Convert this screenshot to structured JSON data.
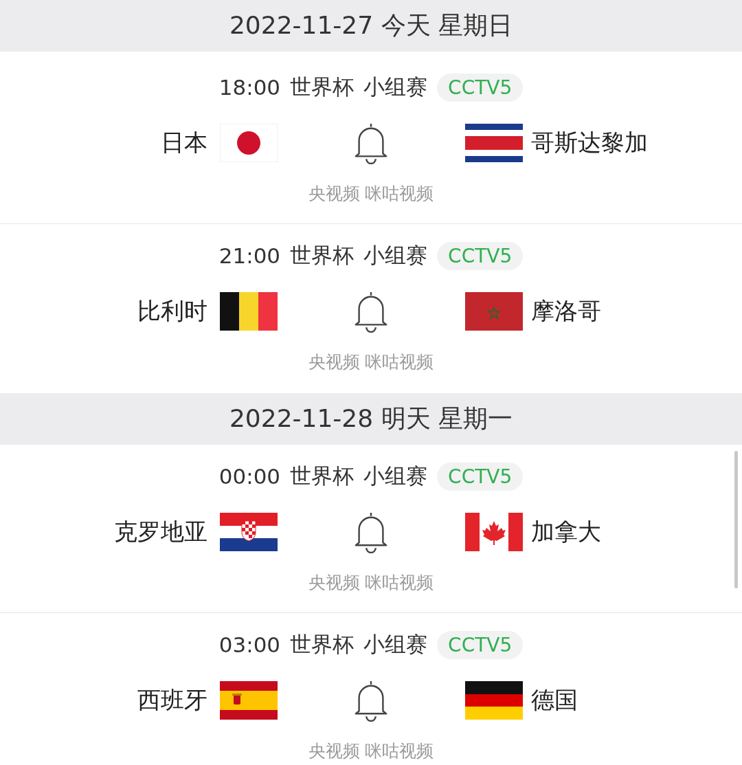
{
  "days": [
    {
      "date": "2022-11-27 今天 星期日",
      "matches": [
        {
          "time": "18:00",
          "competition": "世界杯",
          "stage": "小组赛",
          "channel": "CCTV5",
          "home": {
            "name": "日本",
            "kind": "jp"
          },
          "away": {
            "name": "哥斯达黎加",
            "kind": "cr"
          },
          "sources": "央视频 咪咕视频"
        },
        {
          "time": "21:00",
          "competition": "世界杯",
          "stage": "小组赛",
          "channel": "CCTV5",
          "home": {
            "name": "比利时",
            "kind": "be"
          },
          "away": {
            "name": "摩洛哥",
            "kind": "ma"
          },
          "sources": "央视频 咪咕视频"
        }
      ]
    },
    {
      "date": "2022-11-28 明天 星期一",
      "matches": [
        {
          "time": "00:00",
          "competition": "世界杯",
          "stage": "小组赛",
          "channel": "CCTV5",
          "home": {
            "name": "克罗地亚",
            "kind": "hr"
          },
          "away": {
            "name": "加拿大",
            "kind": "ca"
          },
          "sources": "央视频 咪咕视频"
        },
        {
          "time": "03:00",
          "competition": "世界杯",
          "stage": "小组赛",
          "channel": "CCTV5",
          "home": {
            "name": "西班牙",
            "kind": "es"
          },
          "away": {
            "name": "德国",
            "kind": "de"
          },
          "sources": "央视频 咪咕视频"
        }
      ]
    }
  ]
}
